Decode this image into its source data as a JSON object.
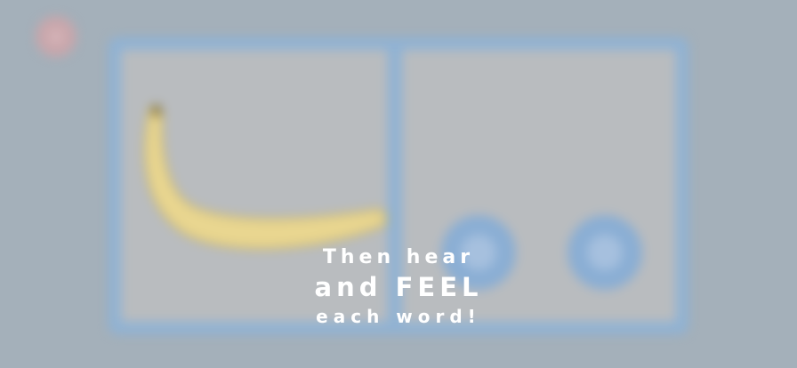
{
  "colors": {
    "background": "#a4b0ba",
    "frame": "#8fb2d4",
    "panel": "#b9bcbf",
    "close_button": "#c9a6ab",
    "round_button": "#8aaed4",
    "text": "#ffffff"
  },
  "close_button": {
    "icon": "close-icon",
    "glyph": "×"
  },
  "overlay": {
    "line1": "Then hear",
    "line2": "and FEEL",
    "line3": "each word!"
  },
  "panels": {
    "left": {
      "image": "banana-image"
    },
    "right": {
      "buttons": [
        {
          "icon": "letter-a-icon",
          "glyph": "a"
        },
        {
          "icon": "letter-b-icon",
          "glyph": "b"
        }
      ]
    }
  }
}
